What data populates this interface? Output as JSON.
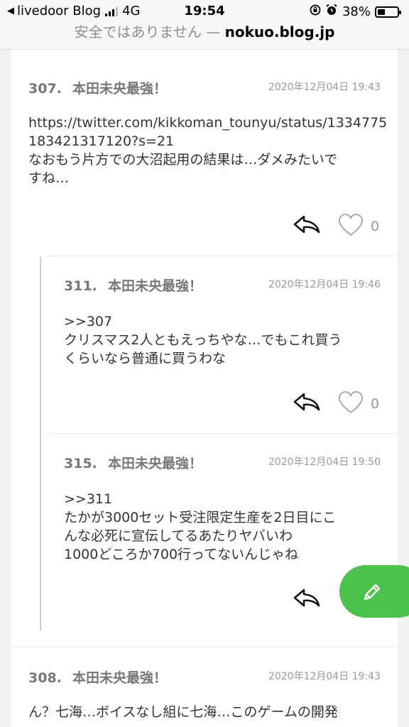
{
  "status_bar": {
    "back_app": "livedoor Blog",
    "network": "4G",
    "time": "19:54",
    "battery": "38%",
    "battery_level": 0.38
  },
  "url_bar": {
    "insecure_label": "安全ではありません —",
    "domain": "nokuo.blog.jp"
  },
  "comments": [
    {
      "number": "307.",
      "name": "本田未央最強！",
      "date": "2020年12月04日 19:43",
      "lines": [
        "https://twitter.com/kikkoman_tounyu/status/1334775",
        "183421317120?s=21",
        "なおもう片方での大沼起用の結果は…ダメみたいで",
        "すね…"
      ],
      "likes": "0"
    },
    {
      "number": "311.",
      "name": "本田未央最強！",
      "date": "2020年12月04日 19:46",
      "lines": [
        ">>307",
        "クリスマス2人ともえっちやな…でもこれ買う",
        "くらいなら普通に買うわな"
      ],
      "likes": "0"
    },
    {
      "number": "315.",
      "name": "本田未央最強！",
      "date": "2020年12月04日 19:50",
      "lines": [
        ">>311",
        "たかが3000セット受注限定生産を2日目にこ",
        "んな必死に宣伝してるあたりヤバいわ",
        "1000どころか700行ってないんじゃね"
      ]
    },
    {
      "number": "308.",
      "name": "本田未央最強！",
      "date": "2020年12月04日 19:43",
      "lines": [
        "ん？七海…ボイスなし組に七海…このゲームの開発"
      ]
    }
  ],
  "colors": {
    "fab": "#4cc24c",
    "meta_text": "#777777",
    "date_text": "#999999"
  },
  "icons": {
    "reply": "reply-arrow-icon",
    "like": "heart-outline-icon",
    "compose": "pencil-icon"
  }
}
